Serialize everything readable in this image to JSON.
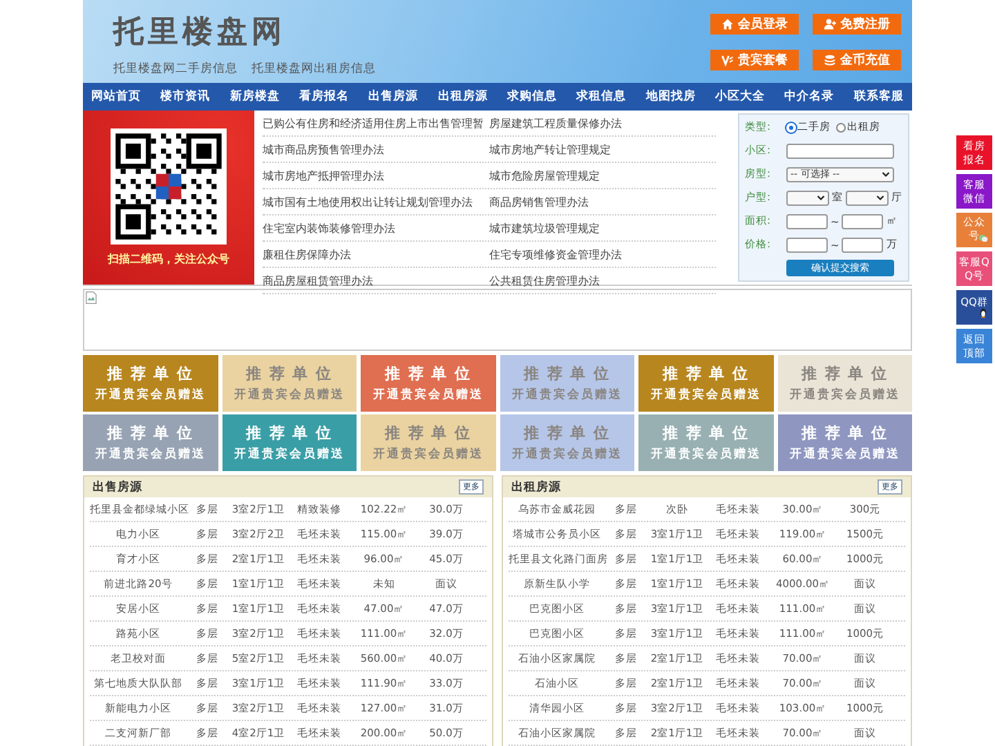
{
  "header": {
    "logo": "托里楼盘网",
    "sublinks": [
      "托里楼盘网二手房信息",
      "托里楼盘网出租房信息"
    ],
    "buttons": [
      {
        "label": "会员登录",
        "kind": "login"
      },
      {
        "label": "免费注册",
        "kind": "register"
      },
      {
        "label": "贵宾套餐",
        "kind": "vip"
      },
      {
        "label": "金币充值",
        "kind": "recharge"
      }
    ]
  },
  "nav": [
    "网站首页",
    "楼市资讯",
    "新房楼盘",
    "看房报名",
    "出售房源",
    "出租房源",
    "求购信息",
    "求租信息",
    "地图找房",
    "小区大全",
    "中介名录",
    "联系客服"
  ],
  "qr": {
    "caption": "扫描二维码，关注公众号"
  },
  "news": [
    [
      "已购公有住房和经济适用住房上市出售管理暂",
      "房屋建筑工程质量保修办法"
    ],
    [
      "城市商品房预售管理办法",
      "城市房地产转让管理规定"
    ],
    [
      "城市房地产抵押管理办法",
      "城市危险房屋管理规定"
    ],
    [
      "城市国有土地使用权出让转让规划管理办法",
      "商品房销售管理办法"
    ],
    [
      "住宅室内装饰装修管理办法",
      "城市建筑垃圾管理规定"
    ],
    [
      "廉租住房保障办法",
      "住宅专项维修资金管理办法"
    ],
    [
      "商品房屋租赁管理办法",
      "公共租赁住房管理办法"
    ]
  ],
  "search": {
    "type_label": "类型:",
    "types": [
      {
        "label": "二手房",
        "selected": true
      },
      {
        "label": "出租房",
        "selected": false
      }
    ],
    "community_label": "小区:",
    "house_label": "房型:",
    "house_value": "-- 可选择 --",
    "layout_label": "户型:",
    "room_unit": "室",
    "hall_unit": "厅",
    "area_label": "面积:",
    "area_sep": "~",
    "area_unit": "㎡",
    "price_label": "价格:",
    "price_sep": "~",
    "price_unit": "万",
    "submit": "确认提交搜索"
  },
  "ads": [
    {
      "title": "推 荐 单 位",
      "subtitle": "开通贵宾会员赠送",
      "color": "#b8861e"
    },
    {
      "title": "推 荐 单 位",
      "subtitle": "开通贵宾会员赠送",
      "color": "#ead3a0"
    },
    {
      "title": "推 荐 单 位",
      "subtitle": "开通贵宾会员赠送",
      "color": "#e06e50"
    },
    {
      "title": "推 荐 单 位",
      "subtitle": "开通贵宾会员赠送",
      "color": "#b6c6e8"
    },
    {
      "title": "推 荐 单 位",
      "subtitle": "开通贵宾会员赠送",
      "color": "#b8861e"
    },
    {
      "title": "推 荐 单 位",
      "subtitle": "开通贵宾会员赠送",
      "color": "#e9e4d6"
    },
    {
      "title": "推 荐 单 位",
      "subtitle": "开通贵宾会员赠送",
      "color": "#97a3b3"
    },
    {
      "title": "推 荐 单 位",
      "subtitle": "开通贵宾会员赠送",
      "color": "#3a9ea6"
    },
    {
      "title": "推 荐 单 位",
      "subtitle": "开通贵宾会员赠送",
      "color": "#ead3a0"
    },
    {
      "title": "推 荐 单 位",
      "subtitle": "开通贵宾会员赠送",
      "color": "#b6c6e8"
    },
    {
      "title": "推 荐 单 位",
      "subtitle": "开通贵宾会员赠送",
      "color": "#98b0b2"
    },
    {
      "title": "推 荐 单 位",
      "subtitle": "开通贵宾会员赠送",
      "color": "#8f96c0"
    }
  ],
  "tables": [
    {
      "title": "出售房源",
      "more": "更多",
      "rows": [
        [
          "托里县金都绿城小区",
          "多层",
          "3室2厅1卫",
          "精致装修",
          "102.22㎡",
          "30.0万"
        ],
        [
          "电力小区",
          "多层",
          "3室2厅2卫",
          "毛坯未装",
          "115.00㎡",
          "39.0万"
        ],
        [
          "育才小区",
          "多层",
          "2室1厅1卫",
          "毛坯未装",
          "96.00㎡",
          "45.0万"
        ],
        [
          "前进北路20号",
          "多层",
          "1室1厅1卫",
          "毛坯未装",
          "未知",
          "面议"
        ],
        [
          "安居小区",
          "多层",
          "1室1厅1卫",
          "毛坯未装",
          "47.00㎡",
          "47.0万"
        ],
        [
          "路苑小区",
          "多层",
          "3室2厅1卫",
          "毛坯未装",
          "111.00㎡",
          "32.0万"
        ],
        [
          "老卫校对面",
          "多层",
          "5室2厅1卫",
          "毛坯未装",
          "560.00㎡",
          "40.0万"
        ],
        [
          "第七地质大队队部",
          "多层",
          "3室1厅1卫",
          "毛坯未装",
          "111.90㎡",
          "33.0万"
        ],
        [
          "新能电力小区",
          "多层",
          "3室2厅1卫",
          "毛坯未装",
          "127.00㎡",
          "31.0万"
        ],
        [
          "二支河新厂部",
          "多层",
          "4室2厅1卫",
          "毛坯未装",
          "200.00㎡",
          "50.0万"
        ]
      ]
    },
    {
      "title": "出租房源",
      "more": "更多",
      "rows": [
        [
          "乌苏市金威花园",
          "多层",
          "次卧",
          "毛坯未装",
          "30.00㎡",
          "300元"
        ],
        [
          "塔城市公务员小区",
          "多层",
          "3室1厅1卫",
          "毛坯未装",
          "119.00㎡",
          "1500元"
        ],
        [
          "托里县文化路门面房",
          "多层",
          "1室1厅1卫",
          "毛坯未装",
          "60.00㎡",
          "1000元"
        ],
        [
          "原新生队小学",
          "多层",
          "1室1厅1卫",
          "毛坯未装",
          "4000.00㎡",
          "面议"
        ],
        [
          "巴克图小区",
          "多层",
          "3室1厅1卫",
          "毛坯未装",
          "111.00㎡",
          "面议"
        ],
        [
          "巴克图小区",
          "多层",
          "3室1厅1卫",
          "毛坯未装",
          "111.00㎡",
          "1000元"
        ],
        [
          "石油小区家属院",
          "多层",
          "2室1厅1卫",
          "毛坯未装",
          "70.00㎡",
          "面议"
        ],
        [
          "石油小区",
          "多层",
          "2室1厅1卫",
          "毛坯未装",
          "70.00㎡",
          "面议"
        ],
        [
          "清华园小区",
          "多层",
          "3室2厅1卫",
          "毛坯未装",
          "103.00㎡",
          "1000元"
        ],
        [
          "石油小区家属院",
          "多层",
          "2室1厅1卫",
          "毛坯未装",
          "70.00㎡",
          "面议"
        ]
      ]
    }
  ],
  "float": [
    {
      "label": "看房报名",
      "color": "#e8132a",
      "kind": "plain"
    },
    {
      "label": "客服微信",
      "color": "#8a17c8",
      "kind": "plain"
    },
    {
      "label": "公众号",
      "color": "#e8803a",
      "kind": "wechat"
    },
    {
      "label": "客服QQ号",
      "color": "#e8507a",
      "kind": "plain"
    },
    {
      "label": "QQ群",
      "color": "#2a4f9a",
      "kind": "qq"
    },
    {
      "label": "返回顶部",
      "color": "#3a84d8",
      "kind": "plain"
    }
  ]
}
